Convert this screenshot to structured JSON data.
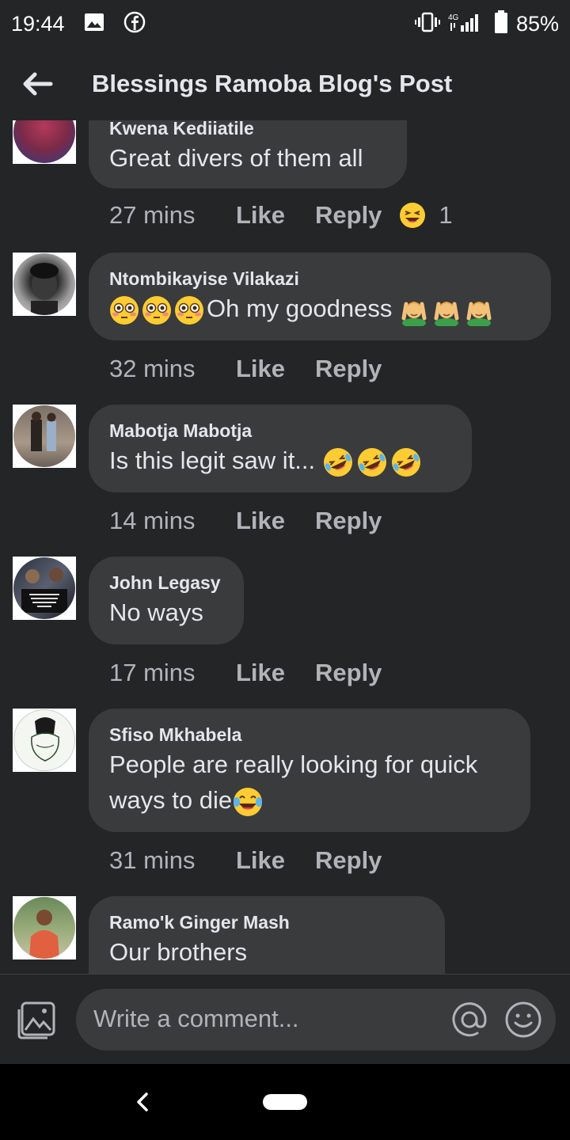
{
  "status_bar": {
    "time": "19:44",
    "network": "4G",
    "battery": "85%"
  },
  "header": {
    "title": "Blessings Ramoba Blog's Post"
  },
  "comments": [
    {
      "name": "Kwena Kediiatile",
      "text": "Great divers of them all",
      "time": "27 mins",
      "like": "Like",
      "reply": "Reply",
      "reaction_count": "1"
    },
    {
      "name": "Ntombikayise Vilakazi",
      "text": "Oh my goodness ",
      "time": "32 mins",
      "like": "Like",
      "reply": "Reply"
    },
    {
      "name": "Mabotja Mabotja",
      "text": "Is this legit saw it... ",
      "time": "14 mins",
      "like": "Like",
      "reply": "Reply"
    },
    {
      "name": "John Legasy",
      "text": "No ways",
      "time": "17 mins",
      "like": "Like",
      "reply": "Reply"
    },
    {
      "name": "Sfiso Mkhabela",
      "text_line1": "People are really looking for quick",
      "text_line2": "ways to die",
      "time": "31 mins",
      "like": "Like",
      "reply": "Reply"
    },
    {
      "name": "Ramo'k Ginger Mash",
      "text": "Our brothers"
    }
  ],
  "composer": {
    "placeholder": "Write a comment..."
  },
  "icons": [
    "back-arrow-icon",
    "photo-icon",
    "at-icon",
    "smile-icon",
    "gallery-icon",
    "facebook-icon",
    "vibrate-icon",
    "signal-icon",
    "battery-icon",
    "nav-back-icon",
    "home-pill-icon"
  ],
  "colors": {
    "background": "#242526",
    "bubble": "#3a3b3c",
    "text": "#e4e6eb",
    "secondary": "#b0b3b8"
  }
}
